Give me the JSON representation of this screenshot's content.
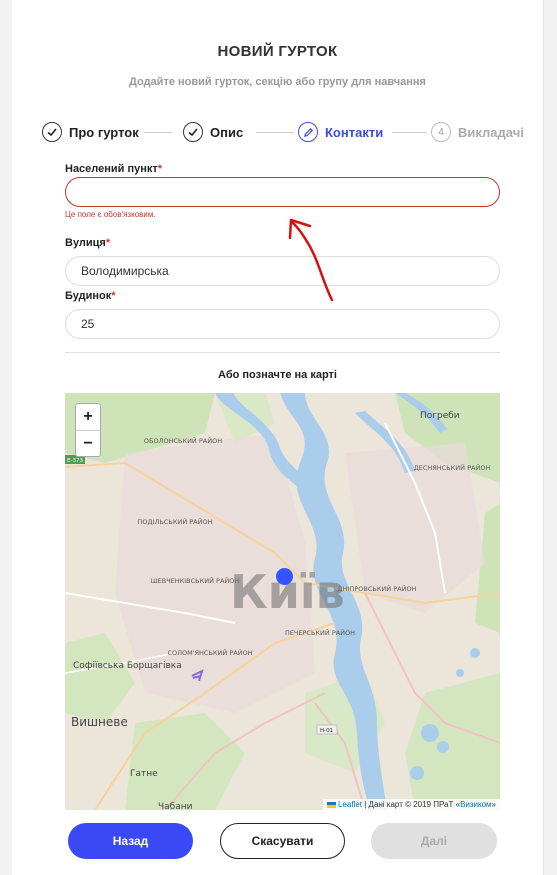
{
  "header": {
    "title": "НОВИЙ ГУРТОК",
    "subtitle": "Додайте новий гурток, секцію або групу для навчання"
  },
  "steps": [
    {
      "label": "Про гурток",
      "state": "done",
      "icon": "check-icon"
    },
    {
      "label": "Опис",
      "state": "done",
      "icon": "check-icon"
    },
    {
      "label": "Контакти",
      "state": "active",
      "icon": "pencil-icon"
    },
    {
      "label": "Викладачі",
      "state": "pending",
      "number": "4"
    }
  ],
  "form": {
    "locality": {
      "label": "Населений пункт",
      "required": "*",
      "value": "",
      "error": "Це поле є обов'язковим."
    },
    "street": {
      "label": "Вулиця",
      "required": "*",
      "value": "Володимирська"
    },
    "building": {
      "label": "Будинок",
      "required": "*",
      "value": "25"
    }
  },
  "map": {
    "caption": "Або позначте на карті",
    "city_label": "Київ",
    "zoom_in": "+",
    "zoom_out": "−",
    "attribution": {
      "link": "Leaflet",
      "text": " | Дані карт © 2019 ПРаТ «",
      "provider": "Визиком",
      "end": "»"
    },
    "places": [
      {
        "name": "ОБОЛОНСЬКИЙ РАЙОН"
      },
      {
        "name": "ПОДІЛЬСЬКИЙ РАЙОН"
      },
      {
        "name": "ШЕВЧЕНКІВСЬКИЙ РАЙОН"
      },
      {
        "name": "СОЛОМ'ЯНСЬКИЙ РАЙОН"
      },
      {
        "name": "ПЕЧЕРСЬКИЙ РАЙОН"
      },
      {
        "name": "ДНІПРОВСЬКИЙ РАЙОН"
      },
      {
        "name": "ДЕСНЯНСЬКИЙ РАЙОН"
      },
      {
        "name": "Погреби"
      },
      {
        "name": "Софіївська Борщагівка"
      },
      {
        "name": "Вишневе"
      },
      {
        "name": "Гатне"
      },
      {
        "name": "Чабани"
      },
      {
        "name": "E-373"
      },
      {
        "name": "Н-01"
      }
    ]
  },
  "buttons": {
    "back": "Назад",
    "cancel": "Скасувати",
    "next": "Далі"
  },
  "colors": {
    "accent": "#3b48f5",
    "error": "#c0392b",
    "disabled": "#e0e0e0"
  }
}
